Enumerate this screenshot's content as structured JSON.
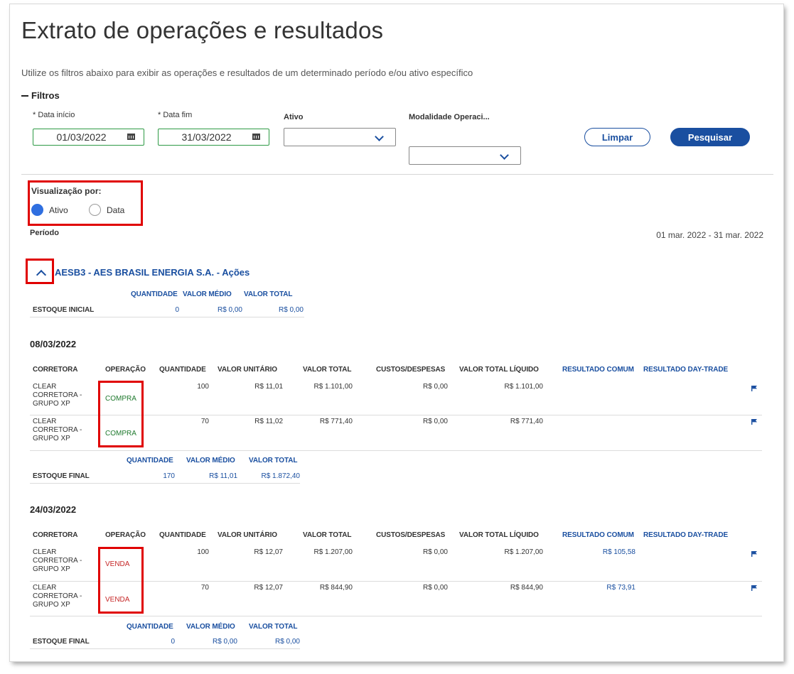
{
  "page": {
    "title": "Extrato de operações e resultados",
    "subtitle": "Utilize os filtros abaixo para exibir as operações e resultados de um determinado período e/ou ativo específico"
  },
  "filters": {
    "toggle_label": "Filtros",
    "date_start_label": "* Data início",
    "date_start_value": "01/03/2022",
    "date_end_label": "* Data fim",
    "date_end_value": "31/03/2022",
    "asset_label": "Ativo",
    "modality_label": "Modalidade Operaci...",
    "clear_button": "Limpar",
    "search_button": "Pesquisar"
  },
  "view": {
    "label": "Visualização por:",
    "options": [
      "Ativo",
      "Data"
    ],
    "selected": "Ativo"
  },
  "period": {
    "label": "Período",
    "value": "01 mar. 2022 - 31 mar. 2022"
  },
  "asset": {
    "title": "AESB3 - AES BRASIL ENERGIA S.A. - Ações",
    "summary_headers": [
      "QUANTIDADE",
      "VALOR MÉDIO",
      "VALOR TOTAL"
    ],
    "initial": {
      "label": "ESTOQUE INICIAL",
      "quantidade": "0",
      "valor_medio": "R$ 0,00",
      "valor_total": "R$ 0,00"
    }
  },
  "table_headers": {
    "corretora": "CORRETORA",
    "operacao": "OPERAÇÃO",
    "quantidade": "QUANTIDADE",
    "valor_unitario": "VALOR UNITÁRIO",
    "valor_total": "VALOR TOTAL",
    "custos": "CUSTOS/DESPESAS",
    "valor_liquido": "VALOR TOTAL LÍQUIDO",
    "resultado_comum": "RESULTADO COMUM",
    "resultado_daytrade": "RESULTADO DAY-TRADE"
  },
  "groups": [
    {
      "date": "08/03/2022",
      "rows": [
        {
          "corretora": [
            "CLEAR",
            "CORRETORA -",
            "GRUPO XP"
          ],
          "operacao": "COMPRA",
          "quantidade": "100",
          "valor_unitario": "R$ 11,01",
          "valor_total": "R$ 1.101,00",
          "custos": "R$ 0,00",
          "valor_liquido": "R$ 1.101,00",
          "resultado_comum": "",
          "resultado_daytrade": ""
        },
        {
          "corretora": [
            "CLEAR",
            "CORRETORA -",
            "GRUPO XP"
          ],
          "operacao": "COMPRA",
          "quantidade": "70",
          "valor_unitario": "R$ 11,02",
          "valor_total": "R$ 771,40",
          "custos": "R$ 0,00",
          "valor_liquido": "R$ 771,40",
          "resultado_comum": "",
          "resultado_daytrade": ""
        }
      ],
      "final": {
        "label": "ESTOQUE FINAL",
        "quantidade": "170",
        "valor_medio": "R$ 11,01",
        "valor_total": "R$ 1.872,40"
      }
    },
    {
      "date": "24/03/2022",
      "rows": [
        {
          "corretora": [
            "CLEAR",
            "CORRETORA -",
            "GRUPO XP"
          ],
          "operacao": "VENDA",
          "quantidade": "100",
          "valor_unitario": "R$ 12,07",
          "valor_total": "R$ 1.207,00",
          "custos": "R$ 0,00",
          "valor_liquido": "R$ 1.207,00",
          "resultado_comum": "R$ 105,58",
          "resultado_daytrade": ""
        },
        {
          "corretora": [
            "CLEAR",
            "CORRETORA -",
            "GRUPO XP"
          ],
          "operacao": "VENDA",
          "quantidade": "70",
          "valor_unitario": "R$ 12,07",
          "valor_total": "R$ 844,90",
          "custos": "R$ 0,00",
          "valor_liquido": "R$ 844,90",
          "resultado_comum": "R$ 73,91",
          "resultado_daytrade": ""
        }
      ],
      "final": {
        "label": "ESTOQUE FINAL",
        "quantidade": "0",
        "valor_medio": "R$ 0,00",
        "valor_total": "R$ 0,00"
      }
    }
  ],
  "colors": {
    "brand_blue": "#1a4fa0",
    "compra_green": "#1f7a2e",
    "venda_red": "#c62828",
    "highlight_red": "#e00000",
    "date_border_green": "#2e9a45"
  }
}
